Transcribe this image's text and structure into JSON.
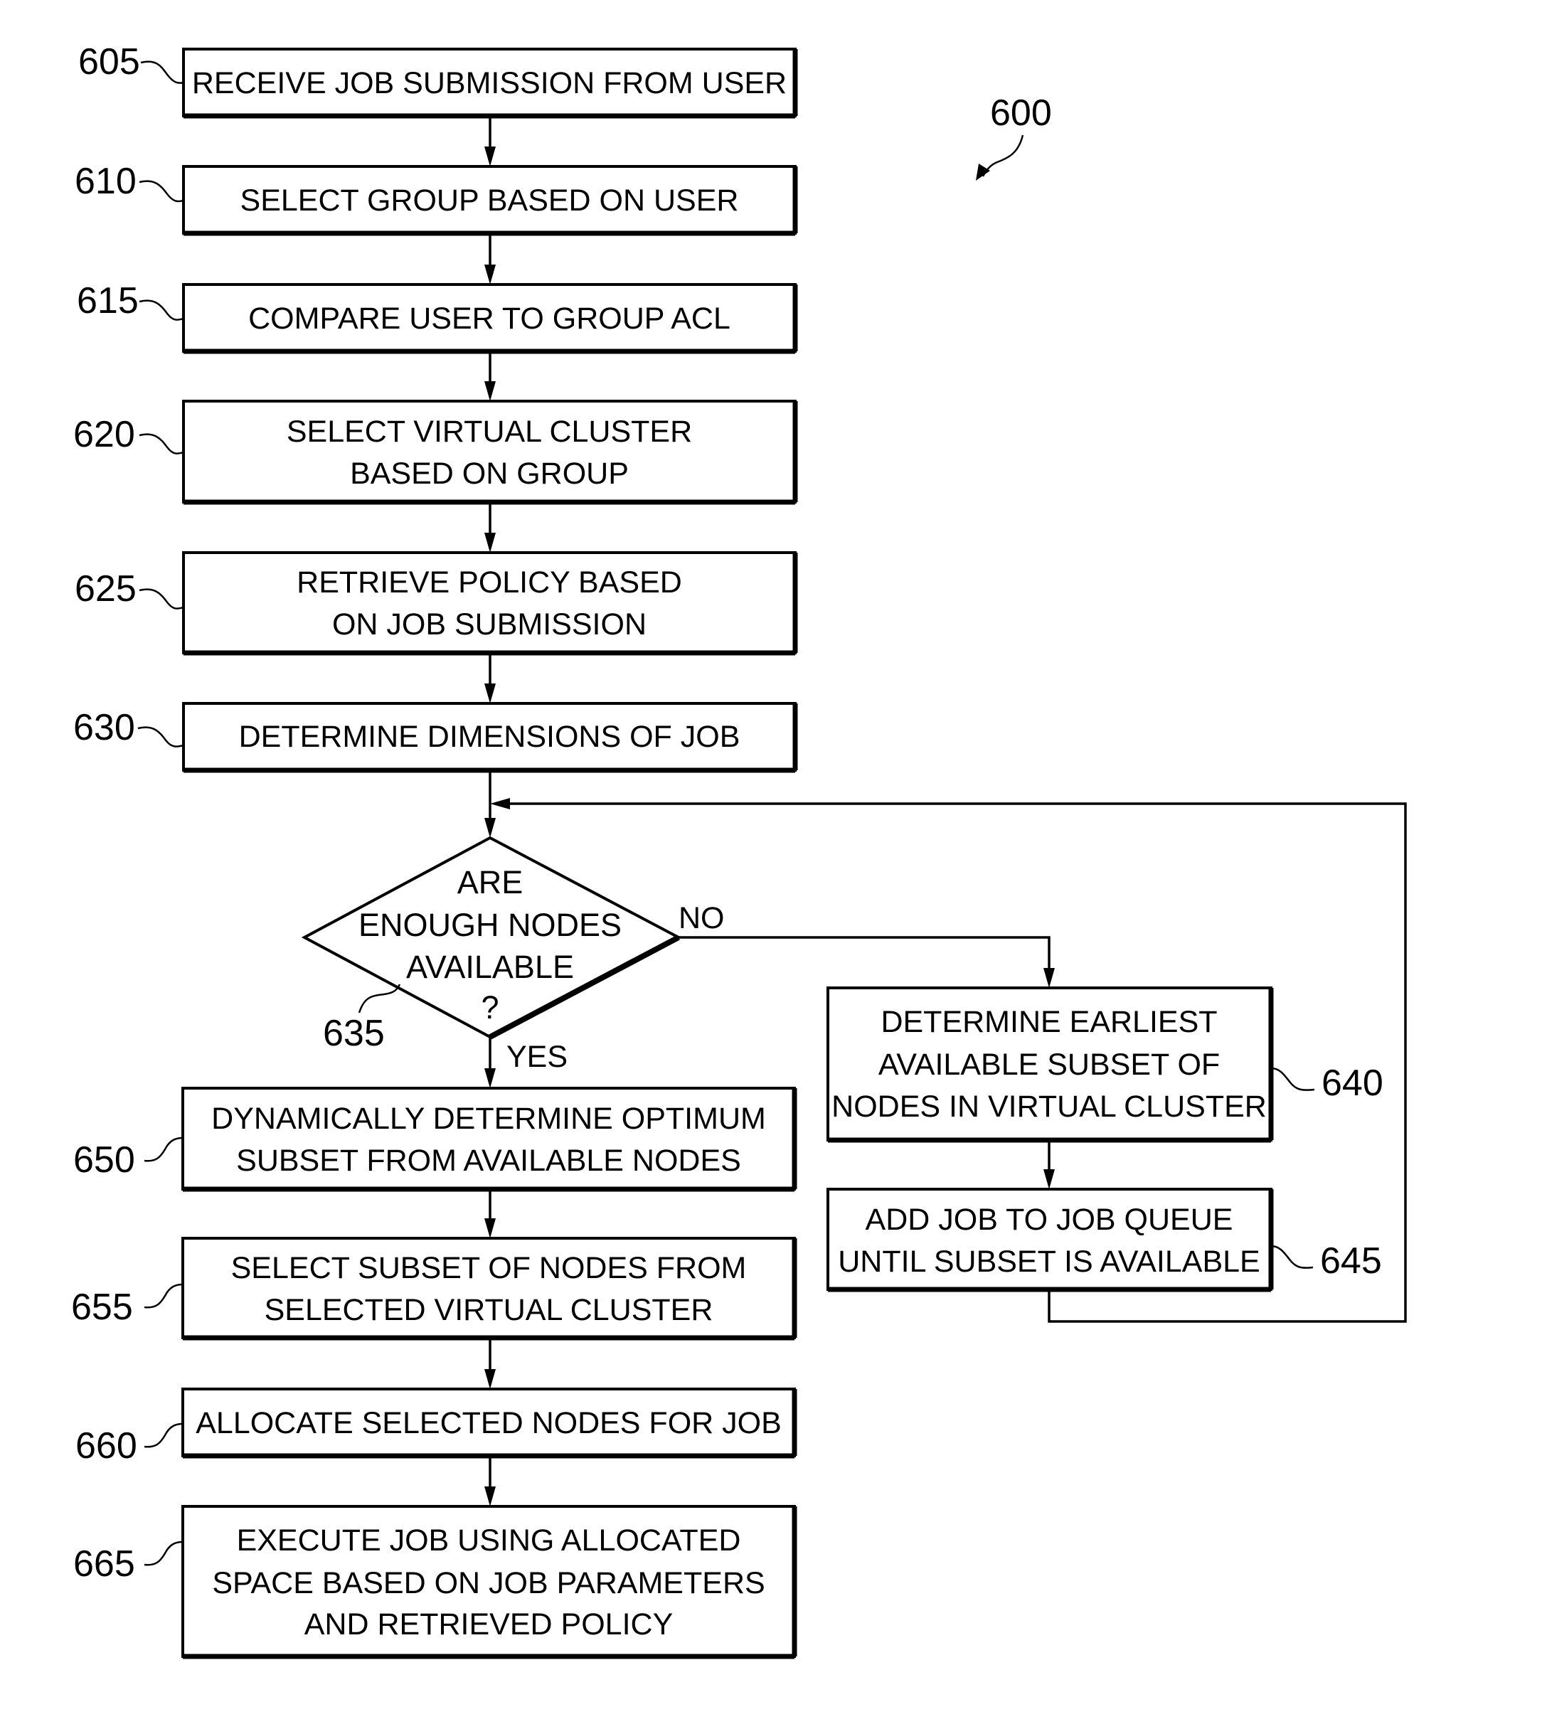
{
  "figure": {
    "reference": "600"
  },
  "steps": [
    {
      "id": "605",
      "lines": [
        "RECEIVE JOB SUBMISSION FROM USER"
      ]
    },
    {
      "id": "610",
      "lines": [
        "SELECT GROUP BASED ON USER"
      ]
    },
    {
      "id": "615",
      "lines": [
        "COMPARE USER TO GROUP ACL"
      ]
    },
    {
      "id": "620",
      "lines": [
        "SELECT VIRTUAL CLUSTER",
        "BASED ON GROUP"
      ]
    },
    {
      "id": "625",
      "lines": [
        "RETRIEVE POLICY BASED",
        "ON JOB SUBMISSION"
      ]
    },
    {
      "id": "630",
      "lines": [
        "DETERMINE DIMENSIONS OF JOB"
      ]
    },
    {
      "id": "650",
      "lines": [
        "DYNAMICALLY DETERMINE OPTIMUM",
        "SUBSET FROM AVAILABLE NODES"
      ]
    },
    {
      "id": "655",
      "lines": [
        "SELECT SUBSET OF NODES FROM",
        "SELECTED VIRTUAL CLUSTER"
      ]
    },
    {
      "id": "660",
      "lines": [
        "ALLOCATE SELECTED NODES FOR JOB"
      ]
    },
    {
      "id": "665",
      "lines": [
        "EXECUTE JOB USING ALLOCATED",
        "SPACE BASED ON JOB PARAMETERS",
        "AND RETRIEVED POLICY"
      ]
    },
    {
      "id": "640",
      "lines": [
        "DETERMINE EARLIEST",
        "AVAILABLE SUBSET OF",
        "NODES IN VIRTUAL CLUSTER"
      ]
    },
    {
      "id": "645",
      "lines": [
        "ADD JOB TO JOB QUEUE",
        "UNTIL SUBSET IS AVAILABLE"
      ]
    }
  ],
  "decision": {
    "id": "635",
    "lines": [
      "ARE",
      "ENOUGH NODES",
      "AVAILABLE",
      "?"
    ],
    "yes_label": "YES",
    "no_label": "NO"
  },
  "labels": {
    "ref_605": "605",
    "ref_610": "610",
    "ref_615": "615",
    "ref_620": "620",
    "ref_625": "625",
    "ref_630": "630",
    "ref_635": "635",
    "ref_640": "640",
    "ref_645": "645",
    "ref_650": "650",
    "ref_655": "655",
    "ref_660": "660",
    "ref_665": "665"
  }
}
